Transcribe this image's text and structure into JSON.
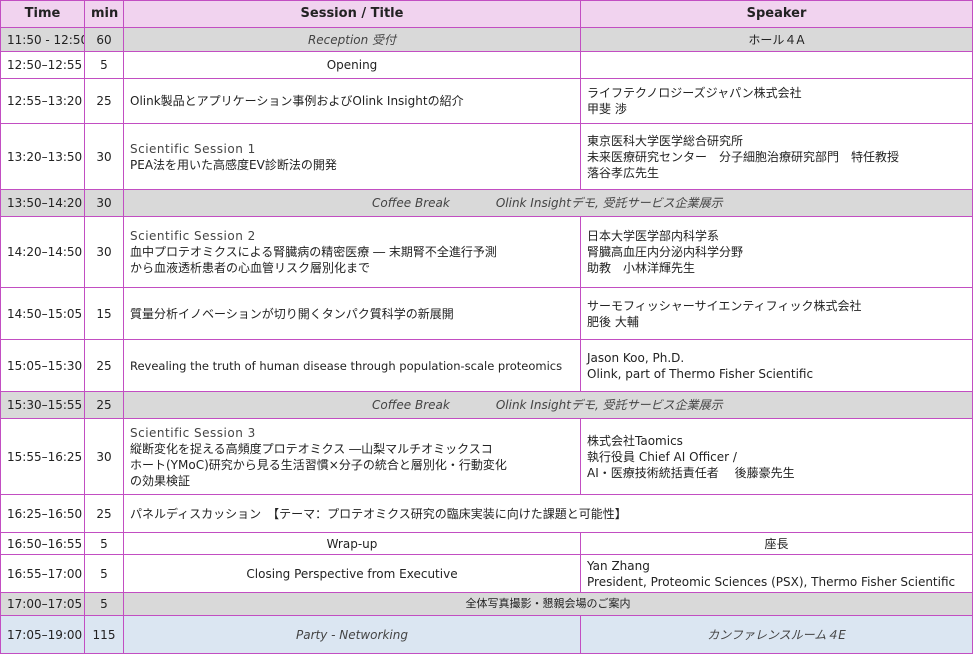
{
  "headers": {
    "time": "Time",
    "min": "min",
    "session": "Session / Title",
    "speaker": "Speaker"
  },
  "rows": [
    {
      "time": "11:50 - 12:50",
      "min": "60",
      "session": "Reception 受付",
      "speaker": "ホール４A"
    },
    {
      "time": "12:50–12:55",
      "min": "5",
      "session": "Opening",
      "speaker": ""
    },
    {
      "time": "12:55–13:20",
      "min": "25",
      "session": "Olink製品とアプリケーション事例およびOlink Insightの紹介",
      "speaker": [
        "ライフテクノロジーズジャパン株式会社",
        "甲斐 渉"
      ]
    },
    {
      "time": "13:20–13:50",
      "min": "30",
      "session_head": "Scientific Session 1",
      "session": [
        "PEA法を用いた高感度EV診断法の開発"
      ],
      "speaker": [
        "東京医科大学医学総合研究所",
        "未来医療研究センター　分子細胞治療研究部門　特任教授",
        "落谷孝広先生"
      ]
    },
    {
      "time": "13:50–14:20",
      "min": "30",
      "break": "Coffee Break",
      "expo": "Olink Insightデモ, 受託サービス企業展示"
    },
    {
      "time": "14:20–14:50",
      "min": "30",
      "session_head": "Scientific Session 2",
      "session": [
        "血中プロテオミクスによる腎臓病の精密医療 ― 末期腎不全進行予測",
        "から血液透析患者の心血管リスク層別化まで"
      ],
      "speaker": [
        "日本大学医学部内科学系",
        "腎臓高血圧内分泌内科学分野",
        "助教　小林洋輝先生"
      ]
    },
    {
      "time": "14:50–15:05",
      "min": "15",
      "session": "質量分析イノベーションが切り開くタンパク質科学の新展開",
      "speaker": [
        "サーモフィッシャーサイエンティフィック株式会社",
        "肥後 大輔"
      ]
    },
    {
      "time": "15:05–15:30",
      "min": "25",
      "session": "Revealing the truth of human disease through population-scale proteomics",
      "speaker": [
        "Jason Koo, Ph.D.",
        "Olink, part of Thermo Fisher Scientific"
      ]
    },
    {
      "time": "15:30–15:55",
      "min": "25",
      "break": "Coffee Break",
      "expo": "Olink Insightデモ, 受託サービス企業展示"
    },
    {
      "time": "15:55–16:25",
      "min": "30",
      "session_head": "Scientific Session 3",
      "session": [
        "縦断変化を捉える高頻度プロテオミクス ―山梨マルチオミックスコ",
        "ホート(YMoC)研究から見る生活習慣×分子の統合と層別化・行動変化",
        "の効果検証"
      ],
      "speaker": [
        "株式会社Taomics",
        "執行役員  Chief AI Officer /",
        "AI・医療技術統括責任者　 後藤豪先生"
      ]
    },
    {
      "time": "16:25–16:50",
      "min": "25",
      "session": "パネルディスカッション　【テーマ：プロテオミクス研究の臨床実装に向けた課題と可能性】"
    },
    {
      "time": "16:50–16:55",
      "min": "5",
      "session": "Wrap-up",
      "speaker": "座長"
    },
    {
      "time": "16:55–17:00",
      "min": "5",
      "session": "Closing Perspective from Executive",
      "speaker": [
        "Yan Zhang",
        "President, Proteomic Sciences (PSX), Thermo Fisher Scientific"
      ]
    },
    {
      "time": "17:00–17:05",
      "min": "5",
      "session": "全体写真撮影・懇親会場のご案内"
    },
    {
      "time": "17:05–19:00",
      "min": "115",
      "session": "Party - Networking",
      "speaker": "カンファレンスルーム４E"
    }
  ]
}
